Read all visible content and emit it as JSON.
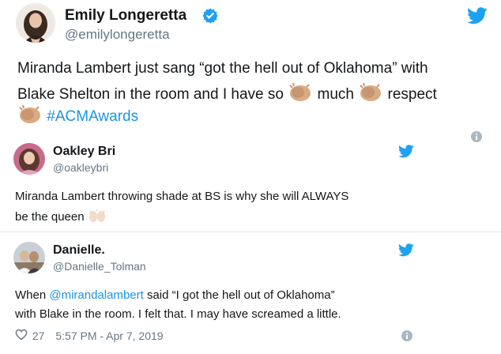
{
  "tweet1": {
    "name": "Emily Longeretta",
    "handle": "@emilylongeretta",
    "line1": "Miranda Lambert just sang “got the hell out of Oklahoma” with",
    "line2a": "Blake Shelton in the room and I have so",
    "line2b": "much",
    "line2c": "respect",
    "hashtag": "#ACMAwards",
    "verified_icon": "verified-badge-icon",
    "emoji": "clapping-hands-emoji"
  },
  "tweet2": {
    "name": "Oakley Bri",
    "handle": "@oakleybri",
    "line1": "Miranda Lambert throwing shade at BS is why she will ALWAYS",
    "line2": "be the queen",
    "emoji": "raising-hands-emoji"
  },
  "tweet3": {
    "name": "Danielle.",
    "handle": "@Danielle_Tolman",
    "line1_prefix": "When",
    "mention": "@mirandalambert",
    "line1_suffix": "said “I got the hell out of Oklahoma”",
    "line2": "with Blake in the room. I felt that. I may have screamed a little.",
    "likes": "27",
    "timestamp": "5:57 PM - Apr 7, 2019"
  },
  "icons": {
    "twitter": "twitter-bird-icon",
    "info": "info-icon",
    "heart": "heart-icon"
  },
  "colors": {
    "twitter_blue": "#1da1f2",
    "link_blue": "#1b95e0",
    "muted_gray": "#657786"
  }
}
